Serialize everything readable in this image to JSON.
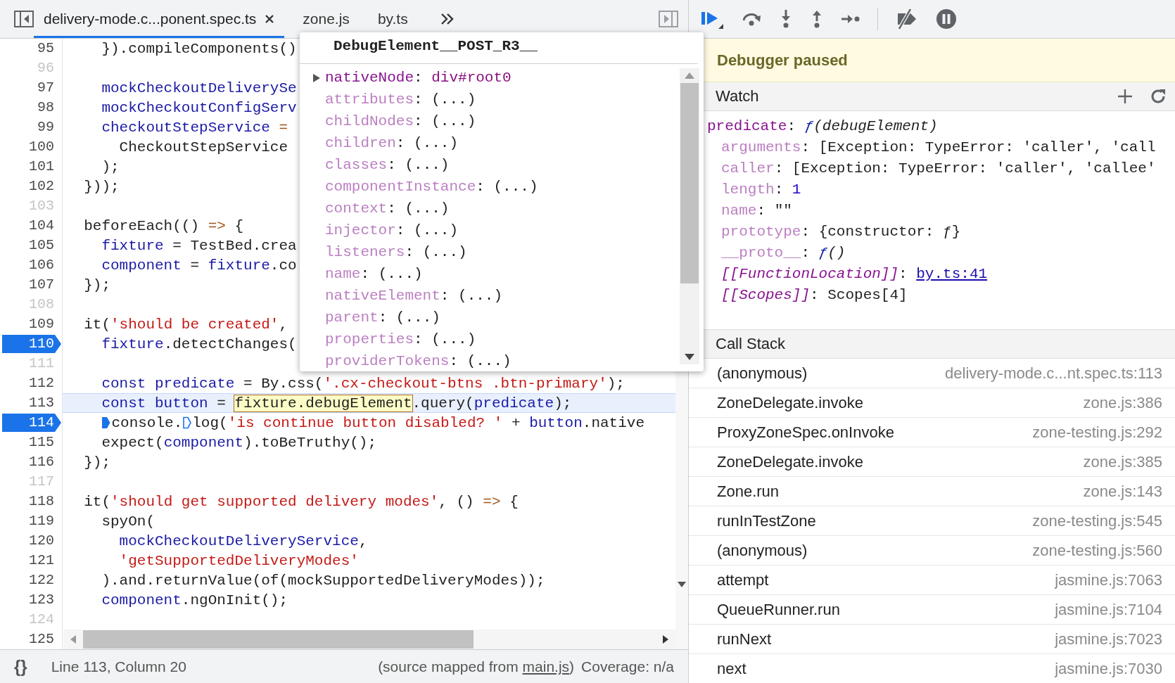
{
  "tabs": [
    {
      "label": "delivery-mode.c...ponent.spec.ts",
      "selected": true,
      "closable": true
    },
    {
      "label": "zone.js",
      "selected": false,
      "closable": false
    },
    {
      "label": "by.ts",
      "selected": false,
      "closable": false
    }
  ],
  "lines": [
    {
      "n": "95",
      "breakable": true,
      "breakpoint": false,
      "current": false,
      "tokens": [
        {
          "kind": "plain",
          "t": "    }).compileComponents()"
        }
      ]
    },
    {
      "n": "96",
      "breakable": false,
      "breakpoint": false,
      "current": false
    },
    {
      "n": "97",
      "breakable": true,
      "breakpoint": false,
      "current": false,
      "tokens": [
        {
          "kind": "variable",
          "t": "    mockCheckoutDeliverySe"
        }
      ]
    },
    {
      "n": "98",
      "breakable": true,
      "breakpoint": false,
      "current": false,
      "tokens": [
        {
          "kind": "variable",
          "t": "    mockCheckoutConfigServ"
        }
      ]
    },
    {
      "n": "99",
      "breakable": true,
      "breakpoint": false,
      "current": false,
      "tokens": [
        {
          "kind": "variable",
          "t": "    checkoutStepService"
        },
        {
          "kind": "operator",
          "t": " ="
        }
      ]
    },
    {
      "n": "100",
      "breakable": true,
      "breakpoint": false,
      "current": false,
      "tokens": [
        {
          "kind": "plain",
          "t": "      CheckoutStepService"
        }
      ]
    },
    {
      "n": "101",
      "breakable": true,
      "breakpoint": false,
      "current": false,
      "tokens": [
        {
          "kind": "plain",
          "t": "    );"
        }
      ]
    },
    {
      "n": "102",
      "breakable": true,
      "breakpoint": false,
      "current": false,
      "tokens": [
        {
          "kind": "plain",
          "t": "  }));"
        }
      ]
    },
    {
      "n": "103",
      "breakable": false,
      "breakpoint": false,
      "current": false
    },
    {
      "n": "104",
      "breakable": true,
      "breakpoint": false,
      "current": false,
      "tokens": [
        {
          "kind": "plain",
          "t": "  beforeEach(() "
        },
        {
          "kind": "operator",
          "t": "=>"
        },
        {
          "kind": "plain",
          "t": " {"
        }
      ]
    },
    {
      "n": "105",
      "breakable": true,
      "breakpoint": false,
      "current": false,
      "tokens": [
        {
          "kind": "variable",
          "t": "    fixture"
        },
        {
          "kind": "plain",
          "t": " = TestBed.crea"
        }
      ]
    },
    {
      "n": "106",
      "breakable": true,
      "breakpoint": false,
      "current": false,
      "tokens": [
        {
          "kind": "variable",
          "t": "    component"
        },
        {
          "kind": "plain",
          "t": " = "
        },
        {
          "kind": "variable",
          "t": "fixture"
        },
        {
          "kind": "plain",
          "t": ".co"
        }
      ]
    },
    {
      "n": "107",
      "breakable": true,
      "breakpoint": false,
      "current": false,
      "tokens": [
        {
          "kind": "plain",
          "t": "  });"
        }
      ]
    },
    {
      "n": "108",
      "breakable": false,
      "breakpoint": false,
      "current": false
    },
    {
      "n": "109",
      "breakable": true,
      "breakpoint": false,
      "current": false,
      "tokens": [
        {
          "kind": "plain",
          "t": "  it("
        },
        {
          "kind": "string",
          "t": "'should be created'"
        },
        {
          "kind": "plain",
          "t": ","
        }
      ]
    },
    {
      "n": "110",
      "breakable": true,
      "breakpoint": true,
      "current": false,
      "tokens": [
        {
          "kind": "variable",
          "t": "    fixture"
        },
        {
          "kind": "plain",
          "t": ".detectChanges("
        }
      ]
    },
    {
      "n": "111",
      "breakable": false,
      "breakpoint": false,
      "current": false
    },
    {
      "n": "112",
      "breakable": true,
      "breakpoint": false,
      "current": false,
      "tokens": [
        {
          "kind": "variable",
          "t": "    const predicate"
        },
        {
          "kind": "plain",
          "t": " = By.css("
        },
        {
          "kind": "string",
          "t": "'.cx-checkout-btns .btn-primary'"
        },
        {
          "kind": "plain",
          "t": ");"
        }
      ]
    },
    {
      "n": "113",
      "breakable": true,
      "breakpoint": false,
      "current": true,
      "tokens": [
        {
          "kind": "variable",
          "t": "    const button"
        },
        {
          "kind": "plain",
          "t": " = "
        },
        {
          "kind": "highlight",
          "t": "fixture.debugElement"
        },
        {
          "kind": "plain",
          "t": ".query("
        },
        {
          "kind": "variable",
          "t": "predicate"
        },
        {
          "kind": "plain",
          "t": ");"
        }
      ]
    },
    {
      "n": "114",
      "breakable": true,
      "breakpoint": true,
      "current": false,
      "tokens": [
        {
          "kind": "marker",
          "active": true
        },
        {
          "kind": "plain",
          "t": "    console."
        },
        {
          "kind": "marker",
          "active": false
        },
        {
          "kind": "plain",
          "t": "log("
        },
        {
          "kind": "string",
          "t": "'is continue button disabled? '"
        },
        {
          "kind": "plain",
          "t": " + "
        },
        {
          "kind": "variable",
          "t": "button"
        },
        {
          "kind": "plain",
          "t": ".native"
        }
      ]
    },
    {
      "n": "115",
      "breakable": true,
      "breakpoint": false,
      "current": false,
      "tokens": [
        {
          "kind": "plain",
          "t": "    expect("
        },
        {
          "kind": "variable",
          "t": "component"
        },
        {
          "kind": "plain",
          "t": ").toBeTruthy();"
        }
      ]
    },
    {
      "n": "116",
      "breakable": true,
      "breakpoint": false,
      "current": false,
      "tokens": [
        {
          "kind": "plain",
          "t": "  });"
        }
      ]
    },
    {
      "n": "117",
      "breakable": false,
      "breakpoint": false,
      "current": false
    },
    {
      "n": "118",
      "breakable": true,
      "breakpoint": false,
      "current": false,
      "tokens": [
        {
          "kind": "plain",
          "t": "  it("
        },
        {
          "kind": "string",
          "t": "'should get supported delivery modes'"
        },
        {
          "kind": "plain",
          "t": ", () "
        },
        {
          "kind": "operator",
          "t": "=>"
        },
        {
          "kind": "plain",
          "t": " {"
        }
      ]
    },
    {
      "n": "119",
      "breakable": true,
      "breakpoint": false,
      "current": false,
      "tokens": [
        {
          "kind": "plain",
          "t": "    spyOn("
        }
      ]
    },
    {
      "n": "120",
      "breakable": true,
      "breakpoint": false,
      "current": false,
      "tokens": [
        {
          "kind": "variable",
          "t": "      mockCheckoutDeliveryService"
        },
        {
          "kind": "plain",
          "t": ","
        }
      ]
    },
    {
      "n": "121",
      "breakable": true,
      "breakpoint": false,
      "current": false,
      "tokens": [
        {
          "kind": "string",
          "t": "      'getSupportedDeliveryModes'"
        }
      ]
    },
    {
      "n": "122",
      "breakable": true,
      "breakpoint": false,
      "current": false,
      "tokens": [
        {
          "kind": "plain",
          "t": "    ).and.returnValue(of(mockSupportedDeliveryModes));"
        }
      ]
    },
    {
      "n": "123",
      "breakable": true,
      "breakpoint": false,
      "current": false,
      "tokens": [
        {
          "kind": "variable",
          "t": "    component"
        },
        {
          "kind": "plain",
          "t": ".ngOnInit();"
        }
      ]
    },
    {
      "n": "124",
      "breakable": false,
      "breakpoint": false,
      "current": false
    },
    {
      "n": "125",
      "breakable": true,
      "breakpoint": false,
      "current": false
    }
  ],
  "popover": {
    "title": "DebugElement__POST_R3__",
    "rows": [
      {
        "kind": "node",
        "key": "nativeNode",
        "sep": ":",
        "value": "div#root0"
      },
      {
        "kind": "getter",
        "key": "attributes",
        "sep": ":",
        "value": "(...)"
      },
      {
        "kind": "getter",
        "key": "childNodes",
        "sep": ":",
        "value": "(...)"
      },
      {
        "kind": "getter",
        "key": "children",
        "sep": ":",
        "value": "(...)"
      },
      {
        "kind": "getter",
        "key": "classes",
        "sep": ":",
        "value": "(...)"
      },
      {
        "kind": "getter",
        "key": "componentInstance",
        "sep": ":",
        "value": "(...)"
      },
      {
        "kind": "getter",
        "key": "context",
        "sep": ":",
        "value": "(...)"
      },
      {
        "kind": "getter",
        "key": "injector",
        "sep": ":",
        "value": "(...)"
      },
      {
        "kind": "getter",
        "key": "listeners",
        "sep": ":",
        "value": "(...)"
      },
      {
        "kind": "getter",
        "key": "name",
        "sep": ":",
        "value": "(...)"
      },
      {
        "kind": "getter",
        "key": "nativeElement",
        "sep": ":",
        "value": "(...)"
      },
      {
        "kind": "getter",
        "key": "parent",
        "sep": ":",
        "value": "(...)"
      },
      {
        "kind": "getter",
        "key": "properties",
        "sep": ":",
        "value": "(...)"
      },
      {
        "kind": "getter",
        "key": "providerTokens",
        "sep": ":",
        "value": "(...)"
      }
    ]
  },
  "status_bar": {
    "pretty_print": "{}",
    "position": "Line 113, Column 20",
    "source_before": "(source mapped from ",
    "source_link": "main.js",
    "source_after": ")",
    "coverage": "Coverage: n/a"
  },
  "paused_message": "Debugger paused",
  "watch": {
    "title": "Watch",
    "items": [
      {
        "kind": "function",
        "key": "predicate",
        "sep": ":",
        "fn": "ƒ",
        "value": "(debugElement)",
        "children": [
          {
            "kind": "hidden",
            "key": "arguments",
            "sep": ":",
            "value": "[Exception: TypeError: 'caller', 'call"
          },
          {
            "kind": "hidden",
            "key": "caller",
            "sep": ":",
            "value": "[Exception: TypeError: 'caller', 'callee'"
          },
          {
            "kind": "hiddenNumber",
            "key": "length",
            "sep": ":",
            "value": "1"
          },
          {
            "kind": "hidden",
            "key": "name",
            "sep": ":",
            "value": "\"\""
          },
          {
            "kind": "hidden",
            "key": "prototype",
            "sep": ":",
            "value": "{constructor: ƒ}"
          },
          {
            "kind": "hiddenFunction",
            "key": "__proto__",
            "sep": ":",
            "fn": "ƒ",
            "value": "()"
          },
          {
            "kind": "internalLink",
            "key": "[[FunctionLocation]]",
            "sep": ":",
            "value": "by.ts:41"
          },
          {
            "kind": "internal",
            "key": "[[Scopes]]",
            "sep": ":",
            "value": "Scopes[4]"
          }
        ]
      }
    ]
  },
  "call_stack": {
    "title": "Call Stack",
    "frames": [
      {
        "name": "(anonymous)",
        "location": "delivery-mode.c...nt.spec.ts:113"
      },
      {
        "name": "ZoneDelegate.invoke",
        "location": "zone.js:386"
      },
      {
        "name": "ProxyZoneSpec.onInvoke",
        "location": "zone-testing.js:292"
      },
      {
        "name": "ZoneDelegate.invoke",
        "location": "zone.js:385"
      },
      {
        "name": "Zone.run",
        "location": "zone.js:143"
      },
      {
        "name": "runInTestZone",
        "location": "zone-testing.js:545"
      },
      {
        "name": "(anonymous)",
        "location": "zone-testing.js:560"
      },
      {
        "name": "attempt",
        "location": "jasmine.js:7063"
      },
      {
        "name": "QueueRunner.run",
        "location": "jasmine.js:7104"
      },
      {
        "name": "runNext",
        "location": "jasmine.js:7023"
      },
      {
        "name": "next",
        "location": "jasmine.js:7030"
      }
    ]
  }
}
